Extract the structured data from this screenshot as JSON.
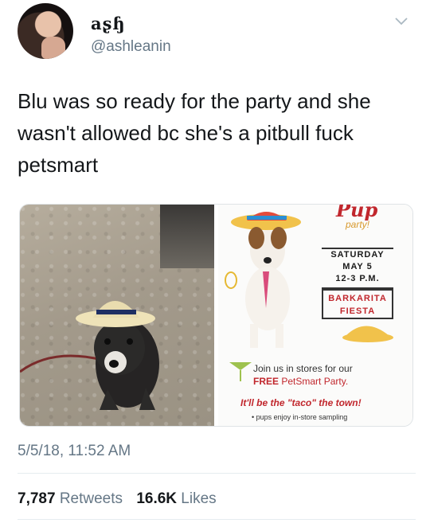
{
  "tweet": {
    "display_name": "aʂɧ",
    "handle": "@ashleanin",
    "text": "Blu was so ready for the party and she wasn't allowed bc she's a pitbull fuck petsmart",
    "timestamp": "5/5/18, 11:52 AM",
    "retweets_count": "7,787",
    "retweets_label": "Retweets",
    "likes_count": "16.6K",
    "likes_label": "Likes"
  },
  "media": {
    "left_photo": "dog-in-sombrero-photo",
    "flyer": {
      "title": "Pup",
      "subtitle": "party!",
      "date_line1": "SATURDAY",
      "date_line2": "MAY 5",
      "date_line3": "12-3 P.M.",
      "event_line1": "BARKARITA",
      "event_line2": "FIESTA",
      "body_prefix": "Join us in stores for our",
      "body_free": "FREE",
      "body_brand": "PetSmart Party.",
      "tagline": "It'll be the \"taco\" the town!",
      "note": "• pups enjoy in-store sampling"
    }
  },
  "icons": {
    "chevron": "chevron-down-icon",
    "avatar": "avatar"
  },
  "colors": {
    "primary_text": "#14171a",
    "secondary_text": "#657786",
    "flyer_red": "#c1272d",
    "divider": "#e6ecf0"
  }
}
